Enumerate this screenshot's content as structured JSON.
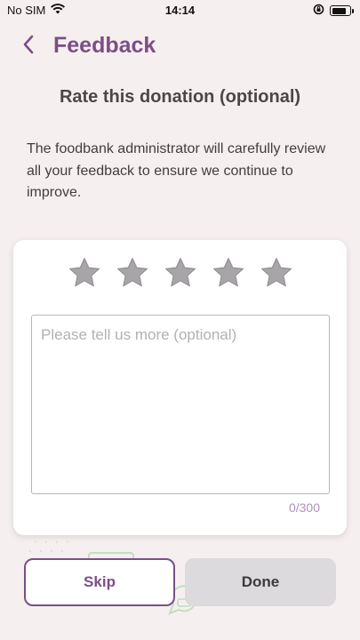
{
  "status_bar": {
    "carrier": "No SIM",
    "time": "14:14",
    "battery_level": 0.85
  },
  "header": {
    "title": "Feedback",
    "back_icon": "chevron-left-icon"
  },
  "subtitle": "Rate this donation (optional)",
  "description": "The foodbank administrator will carefully review all your feedback to ensure we continue to improve.",
  "rating": {
    "max_stars": 5,
    "selected": 0
  },
  "comment": {
    "value": "",
    "placeholder": "Please tell us more (optional)",
    "counter": "0/300"
  },
  "buttons": {
    "skip": "Skip",
    "done": "Done"
  },
  "colors": {
    "accent": "#7b4f86",
    "background": "#f6efef",
    "star_empty": "#a8a5a8",
    "done_bg": "#dcdadc"
  }
}
